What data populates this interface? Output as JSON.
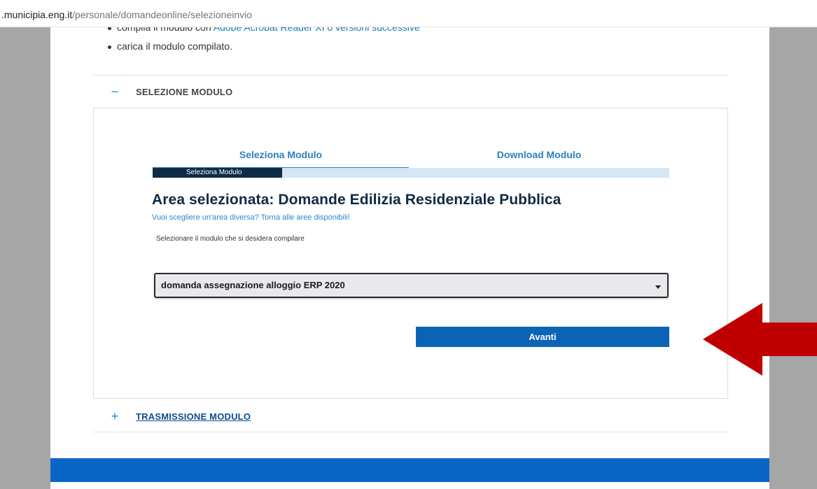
{
  "browser": {
    "url_host": ".municipia.eng.it",
    "url_path": "/personale/domandeonline/selezioneinvio"
  },
  "intro": {
    "bullet_1_text": "compila il modulo con ",
    "bullet_1_link": "Adobe Acrobat Reader XI o versioni successive",
    "bullet_2_text": "carica il modulo compilato."
  },
  "accordion": {
    "selezione": {
      "sign": "−",
      "title": "SELEZIONE MODULO"
    },
    "trasmissione": {
      "sign": "+",
      "title": "TRASMISSIONE MODULO"
    }
  },
  "wizard": {
    "tabs": [
      "Seleziona Modulo",
      "Download Modulo"
    ],
    "progress_label": "Seleziona Modulo",
    "progress_fraction": 0.25
  },
  "form": {
    "area_title": "Area selezionata: Domande Edilizia Residenziale Pubblica",
    "back_link": "Vuoi scegliere un'area diversa? Torna alle aree disponibili!",
    "instruction": "Selezionare il modulo che si desidera compilare",
    "select_value": "domanda assegnazione alloggio ERP 2020",
    "next_button": "Avanti"
  },
  "colors": {
    "accent_blue": "#0b63b5",
    "dark_navy": "#0d2b45",
    "arrow_red": "#c00000"
  }
}
